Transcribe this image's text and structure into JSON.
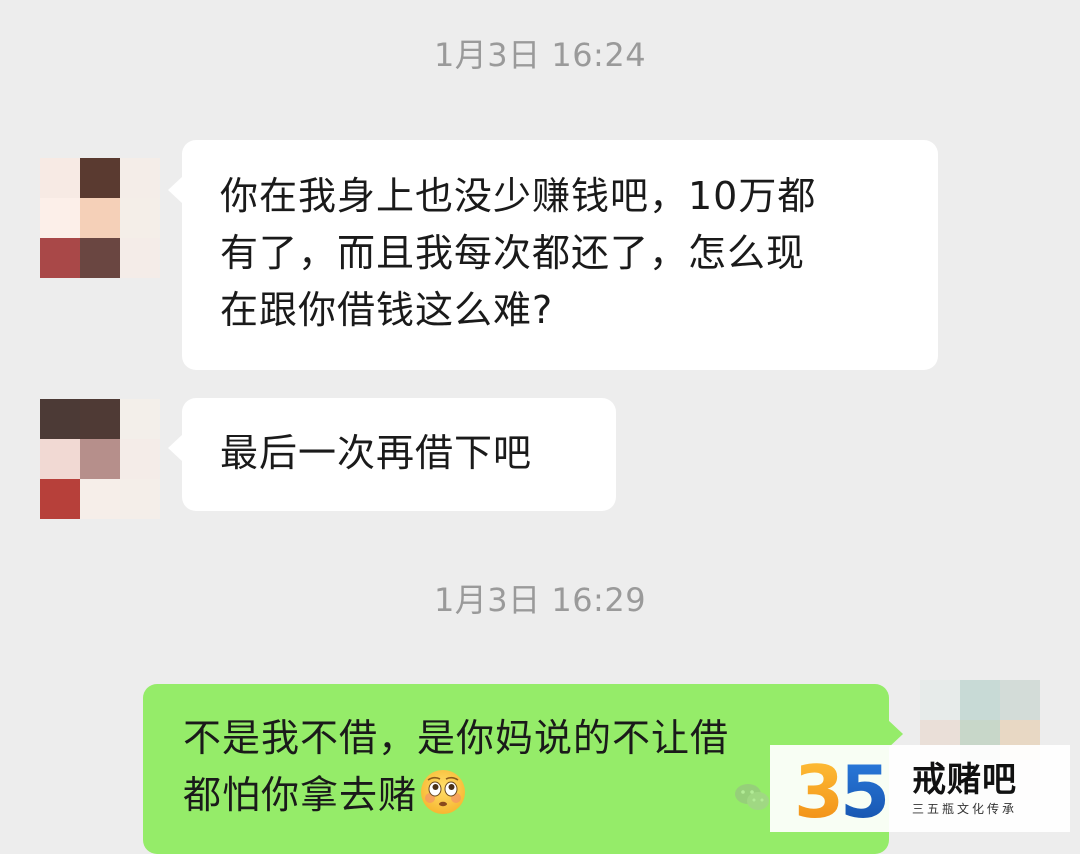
{
  "chat": {
    "timestamps": [
      "1月3日 16:24",
      "1月3日 16:29"
    ],
    "messages": [
      {
        "direction": "incoming",
        "text": "你在我身上也没少赚钱吧，10万都\n有了，而且我每次都还了，怎么现\n在跟你借钱这么难?"
      },
      {
        "direction": "incoming",
        "text": "最后一次再借下吧"
      },
      {
        "direction": "outgoing",
        "text": "不是我不借，是你妈说的不让借\n都怕你拿去赌"
      }
    ]
  },
  "emoji": {
    "name": "flushed-face-emoji"
  },
  "icons": {
    "wechat": "wechat-logo-icon",
    "avatar_style": "pixelated-mosaic"
  },
  "watermark": {
    "logo_number": "35",
    "title": "戒赌吧",
    "subtitle": "三五瓶文化传承"
  },
  "colors": {
    "background": "#ededed",
    "incoming_bubble": "#ffffff",
    "outgoing_bubble": "#95ec69",
    "timestamp_text": "#9a9a9a",
    "logo_orange": "#f5a21b",
    "logo_blue": "#1c62c4"
  },
  "avatars": {
    "contact_1": [
      "#f7eae4",
      "#5a3a30",
      "#f4ede8",
      "#fcefe9",
      "#f5d0b8",
      "#f4eee8",
      "#a94848",
      "#6a4641",
      "#f4ece8"
    ],
    "contact_2": [
      "#4c3a36",
      "#4f3a35",
      "#f3efea",
      "#f1d9d3",
      "#b68f8b",
      "#f4ece8",
      "#b7403a",
      "#f6eee9",
      "#f4eee9"
    ],
    "self": [
      "#e7ebea",
      "#c8dad6",
      "#d3dcd8",
      "#eadfd8",
      "#c8d7c9",
      "#e8d8c4",
      "#f2e6df",
      "#e2e4e0",
      "#e6e1dc"
    ]
  }
}
